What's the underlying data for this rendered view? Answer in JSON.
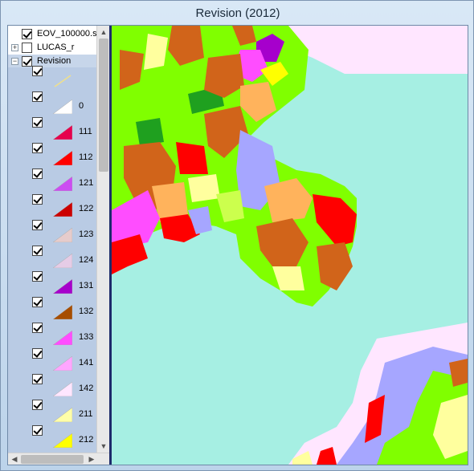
{
  "window": {
    "title": "Revision (2012)"
  },
  "toc": {
    "layers": [
      {
        "label": "EOV_100000.s",
        "checked": true
      },
      {
        "label": "LUCAS_r",
        "checked": false
      },
      {
        "label": "Revision",
        "checked": true
      }
    ],
    "legend": [
      {
        "value": "",
        "color": "#f0e08a",
        "kind": "line"
      },
      {
        "value": "0",
        "color": "#ffffff"
      },
      {
        "value": "111",
        "color": "#e6004d"
      },
      {
        "value": "112",
        "color": "#ff0000"
      },
      {
        "value": "121",
        "color": "#cc4df2"
      },
      {
        "value": "122",
        "color": "#cc0000"
      },
      {
        "value": "123",
        "color": "#e6cccc"
      },
      {
        "value": "124",
        "color": "#e6cce6"
      },
      {
        "value": "131",
        "color": "#a600cc"
      },
      {
        "value": "132",
        "color": "#a64d00"
      },
      {
        "value": "133",
        "color": "#ff4dff"
      },
      {
        "value": "141",
        "color": "#ffa6ff"
      },
      {
        "value": "142",
        "color": "#ffe6ff"
      },
      {
        "value": "211",
        "color": "#ffffa8"
      },
      {
        "value": "212",
        "color": "#ffff00"
      }
    ]
  },
  "map": {
    "sea_color": "#a6efe3",
    "land_colors": [
      "#80ff00",
      "#d1641a",
      "#ffff9e",
      "#a6a6ff",
      "#ffb35c",
      "#ff0000",
      "#ff4dff",
      "#ffe6ff",
      "#1fa01f",
      "#ccff4d"
    ]
  }
}
